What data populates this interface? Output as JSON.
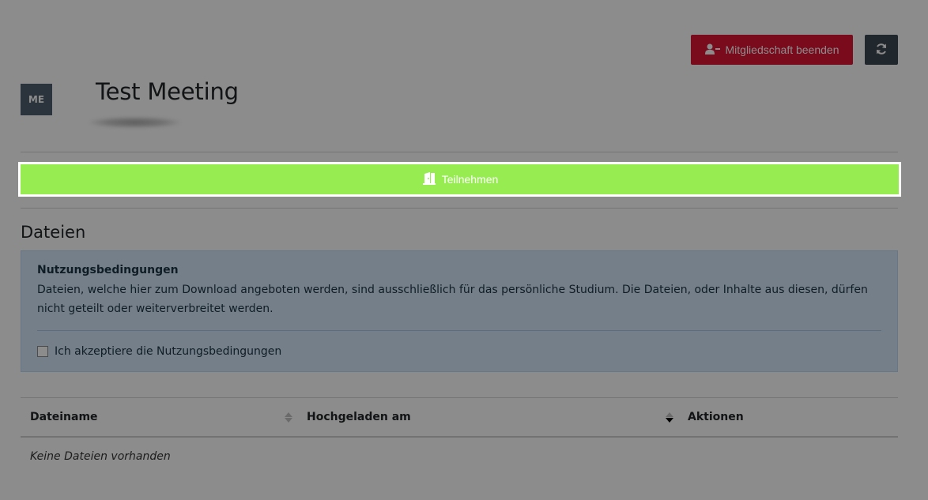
{
  "header": {
    "leave_button_label": "Mitgliedschaft beenden",
    "leave_icon": "user-minus-icon",
    "refresh_icon": "refresh-icon"
  },
  "meeting": {
    "avatar_initials": "ME",
    "title": "Test Meeting"
  },
  "join": {
    "label": "Teilnehmen",
    "icon": "door-open-icon"
  },
  "files": {
    "heading": "Dateien",
    "terms": {
      "title": "Nutzungsbedingungen",
      "text": "Dateien, welche hier zum Download angeboten werden, sind ausschließlich für das persönliche Studium. Die Dateien, oder Inhalte aus diesen, dürfen nicht geteilt oder weiterverbreitet werden.",
      "accept_label": "Ich akzeptiere die Nutzungsbedingungen",
      "accepted": false
    },
    "table": {
      "columns": [
        "Dateiname",
        "Hochgeladen am",
        "Aktionen"
      ],
      "empty_text": "Keine Dateien vorhanden"
    }
  },
  "colors": {
    "danger": "#dc1435",
    "dark": "#3b4752",
    "success": "#97ec52",
    "info_bg": "#d3e8fb"
  }
}
